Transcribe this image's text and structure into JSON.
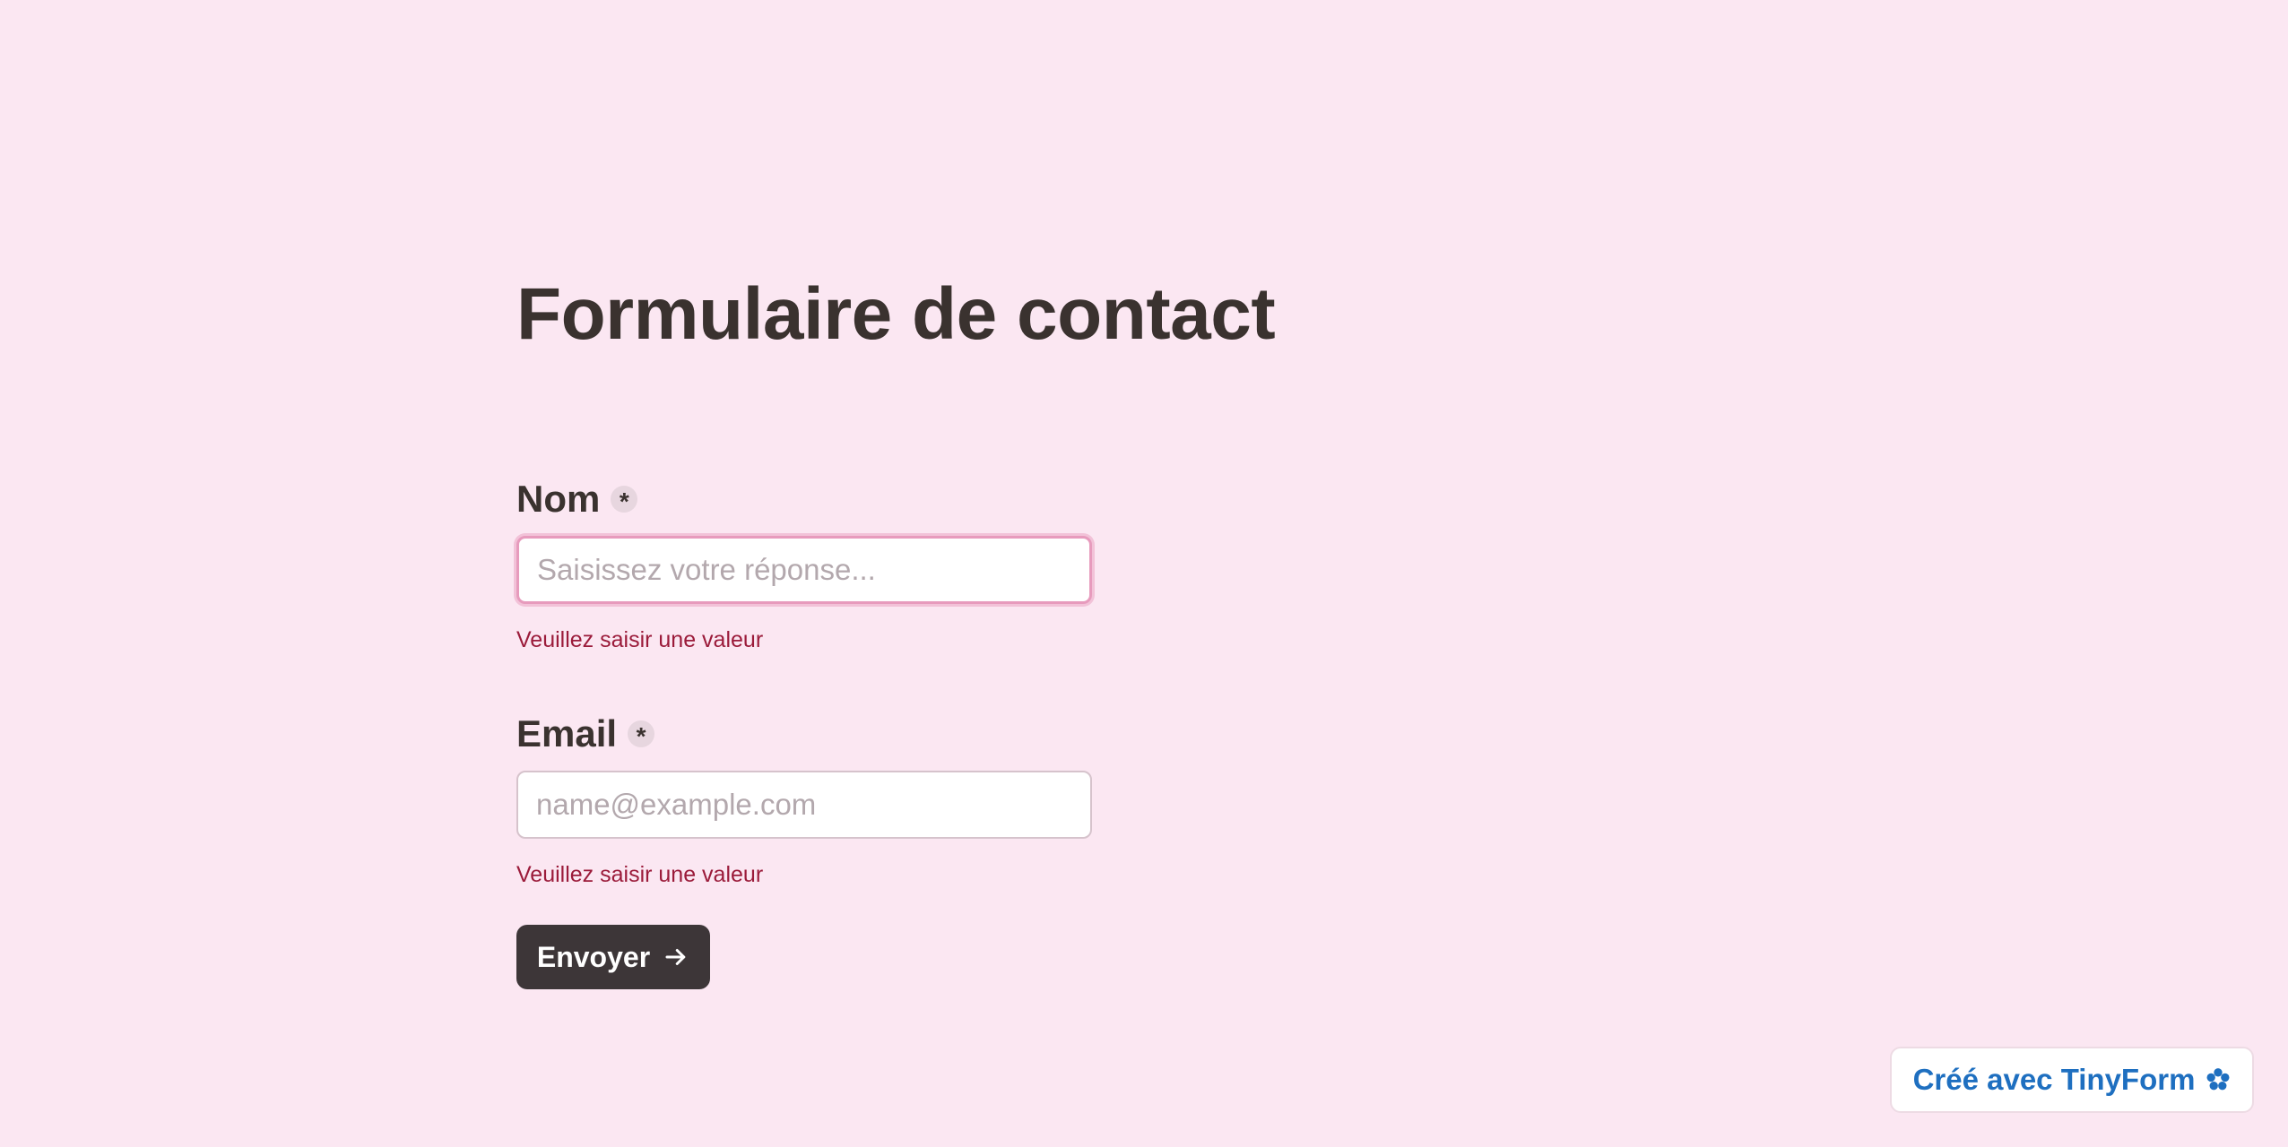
{
  "form": {
    "title": "Formulaire de contact",
    "fields": [
      {
        "label": "Nom",
        "required_mark": "*",
        "placeholder": "Saisissez votre réponse...",
        "value": "",
        "error": "Veuillez saisir une valeur",
        "focused": true
      },
      {
        "label": "Email",
        "required_mark": "*",
        "placeholder": "name@example.com",
        "value": "",
        "error": "Veuillez saisir une valeur",
        "focused": false
      }
    ],
    "submit_label": "Envoyer",
    "submit_icon": "arrow-right-icon"
  },
  "footer": {
    "badge_label": "Créé avec TinyForm",
    "badge_icon": "flower-icon"
  },
  "colors": {
    "background": "#fbe7f2",
    "text": "#3a322f",
    "error": "#9b1b3a",
    "button": "#3d3638",
    "focus_ring": "#e79bbd",
    "badge_text": "#1e6fc0"
  }
}
